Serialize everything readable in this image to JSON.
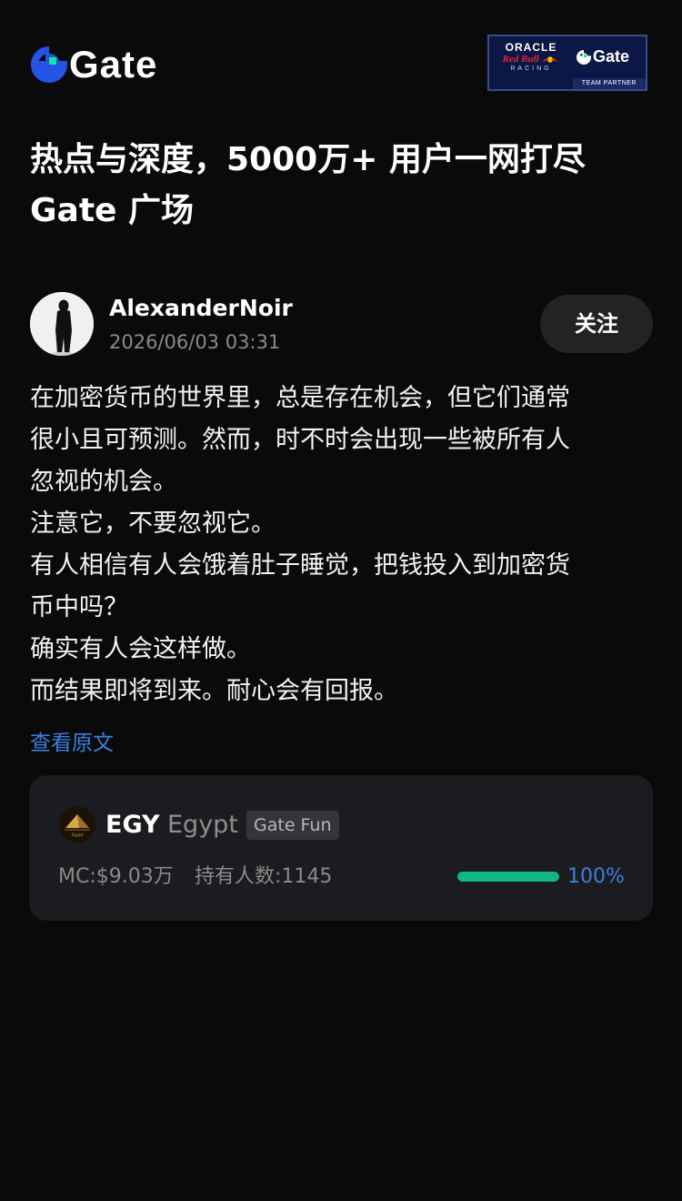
{
  "header": {
    "logo_text": "Gate",
    "partner": {
      "oracle": "ORACLE",
      "redbull": "Red Bull",
      "racing": "RACING",
      "gate": "Gate",
      "team_partner": "TEAM PARTNER"
    }
  },
  "headline": {
    "line1": "热点与深度，5000万+ 用户一网打尽",
    "line2": "Gate 广场"
  },
  "post": {
    "author": "AlexanderNoir",
    "time": "2026/06/03 03:31",
    "follow_label": "关注",
    "lines": [
      "在加密货币的世界里，总是存在机会，但它们通常",
      "很小且可预测。然而，时不时会出现一些被所有人",
      "忽视的机会。",
      "注意它，不要忽视它。",
      "有人相信有人会饿着肚子睡觉，把钱投入到加密货",
      "币中吗？",
      "确实有人会这样做。",
      "而结果即将到来。耐心会有回报。"
    ],
    "view_original": "查看原文"
  },
  "token": {
    "symbol": "EGY",
    "name": "Egypt",
    "tag": "Gate Fun",
    "mc": "MC:$9.03万",
    "holders": "持有人数:1145",
    "progress": 1.0,
    "progress_label": "100%"
  },
  "colors": {
    "background": "#0a0a0a",
    "accent_blue": "#3d7ee0",
    "progress_green": "#10b981",
    "logo_green": "#17e6a1",
    "logo_blue": "#2354e6"
  }
}
